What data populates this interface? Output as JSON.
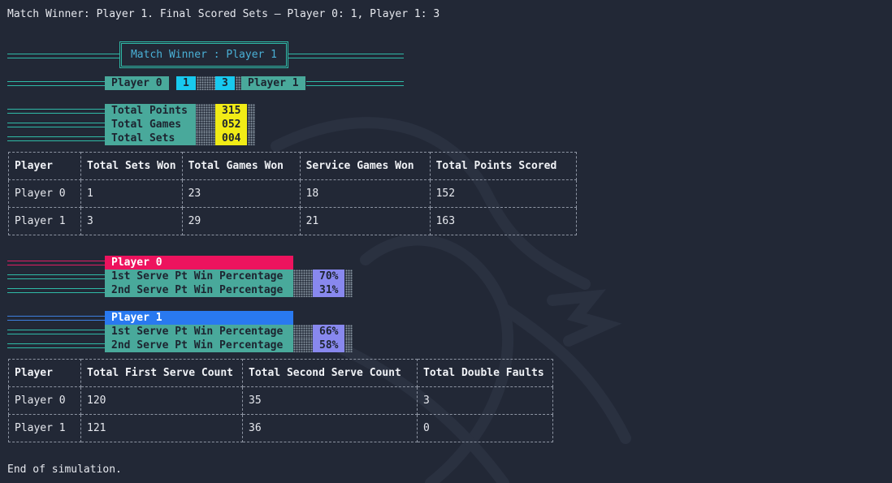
{
  "terminal": {
    "header_line": "Match Winner: Player 1. Final Scored Sets – Player 0: 1, Player 1: 3",
    "footer_line": "End of simulation."
  },
  "winner_banner": {
    "text": "Match Winner : Player 1"
  },
  "scoreboard": {
    "player0_label": "Player 0",
    "player0_sets": "1",
    "player1_sets": "3",
    "player1_label": "Player 1"
  },
  "totals": [
    {
      "label": "Total Points",
      "value": "315"
    },
    {
      "label": "Total Games",
      "value": "052"
    },
    {
      "label": "Total Sets",
      "value": "004"
    }
  ],
  "table1": {
    "headers": [
      "Player",
      "Total Sets Won",
      "Total Games Won",
      "Service Games Won",
      "Total Points Scored"
    ],
    "rows": [
      [
        "Player 0",
        "1",
        "23",
        "18",
        "152"
      ],
      [
        "Player 1",
        "3",
        "29",
        "21",
        "163"
      ]
    ]
  },
  "player0_panel": {
    "title": "Player 0",
    "stats": [
      {
        "label": "1st Serve Pt Win Percentage",
        "value": "70%"
      },
      {
        "label": "2nd Serve Pt Win Percentage",
        "value": "31%"
      }
    ]
  },
  "player1_panel": {
    "title": "Player 1",
    "stats": [
      {
        "label": "1st Serve Pt Win Percentage",
        "value": "66%"
      },
      {
        "label": "2nd Serve Pt Win Percentage",
        "value": "58%"
      }
    ]
  },
  "table2": {
    "headers": [
      "Player",
      "Total First Serve Count",
      "Total Second Serve Count",
      "Total Double Faults"
    ],
    "rows": [
      [
        "Player 0",
        "120",
        "35",
        "3"
      ],
      [
        "Player 1",
        "121",
        "36",
        "0"
      ]
    ]
  },
  "colors": {
    "background": "#222836",
    "teal": "#49a99b",
    "yellow": "#f1ec16",
    "cyan": "#18c9ef",
    "pink": "#ed135e",
    "blue": "#2979f0",
    "violet": "#8888ee"
  }
}
